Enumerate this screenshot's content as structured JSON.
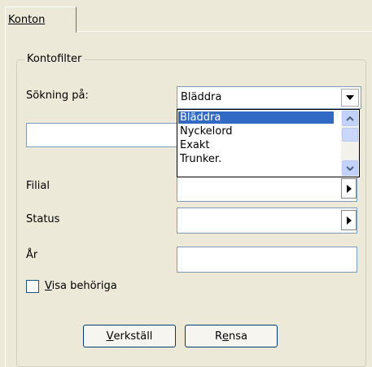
{
  "tabs": [
    {
      "label": "Konton",
      "active": true
    }
  ],
  "group": {
    "title": "Kontofilter"
  },
  "fields": {
    "search_type": {
      "label": "Sökning på:",
      "value": "Bläddra",
      "options": [
        "Bläddra",
        "Nyckelord",
        "Exakt",
        "Trunker."
      ],
      "selected_index": 0
    },
    "search_text": {
      "value": ""
    },
    "branch": {
      "label": "Filial",
      "value": ""
    },
    "status": {
      "label": "Status",
      "value": ""
    },
    "year": {
      "label": "År",
      "value": ""
    }
  },
  "checkbox": {
    "mnemonic": "V",
    "rest": "isa behöriga",
    "checked": false
  },
  "buttons": {
    "apply": {
      "mnemonic": "V",
      "rest": "erkställ"
    },
    "clear": {
      "before": "R",
      "mnemonic": "e",
      "after": "nsa"
    }
  },
  "colors": {
    "background": "#ece9d8",
    "selection": "#316ac5",
    "field_border": "#7f9db9"
  },
  "icons": {
    "combo_arrow": "chevron-down-icon",
    "scroll_up": "chevron-up-icon",
    "scroll_down": "chevron-down-icon",
    "picker_arrow": "triangle-right-icon"
  }
}
